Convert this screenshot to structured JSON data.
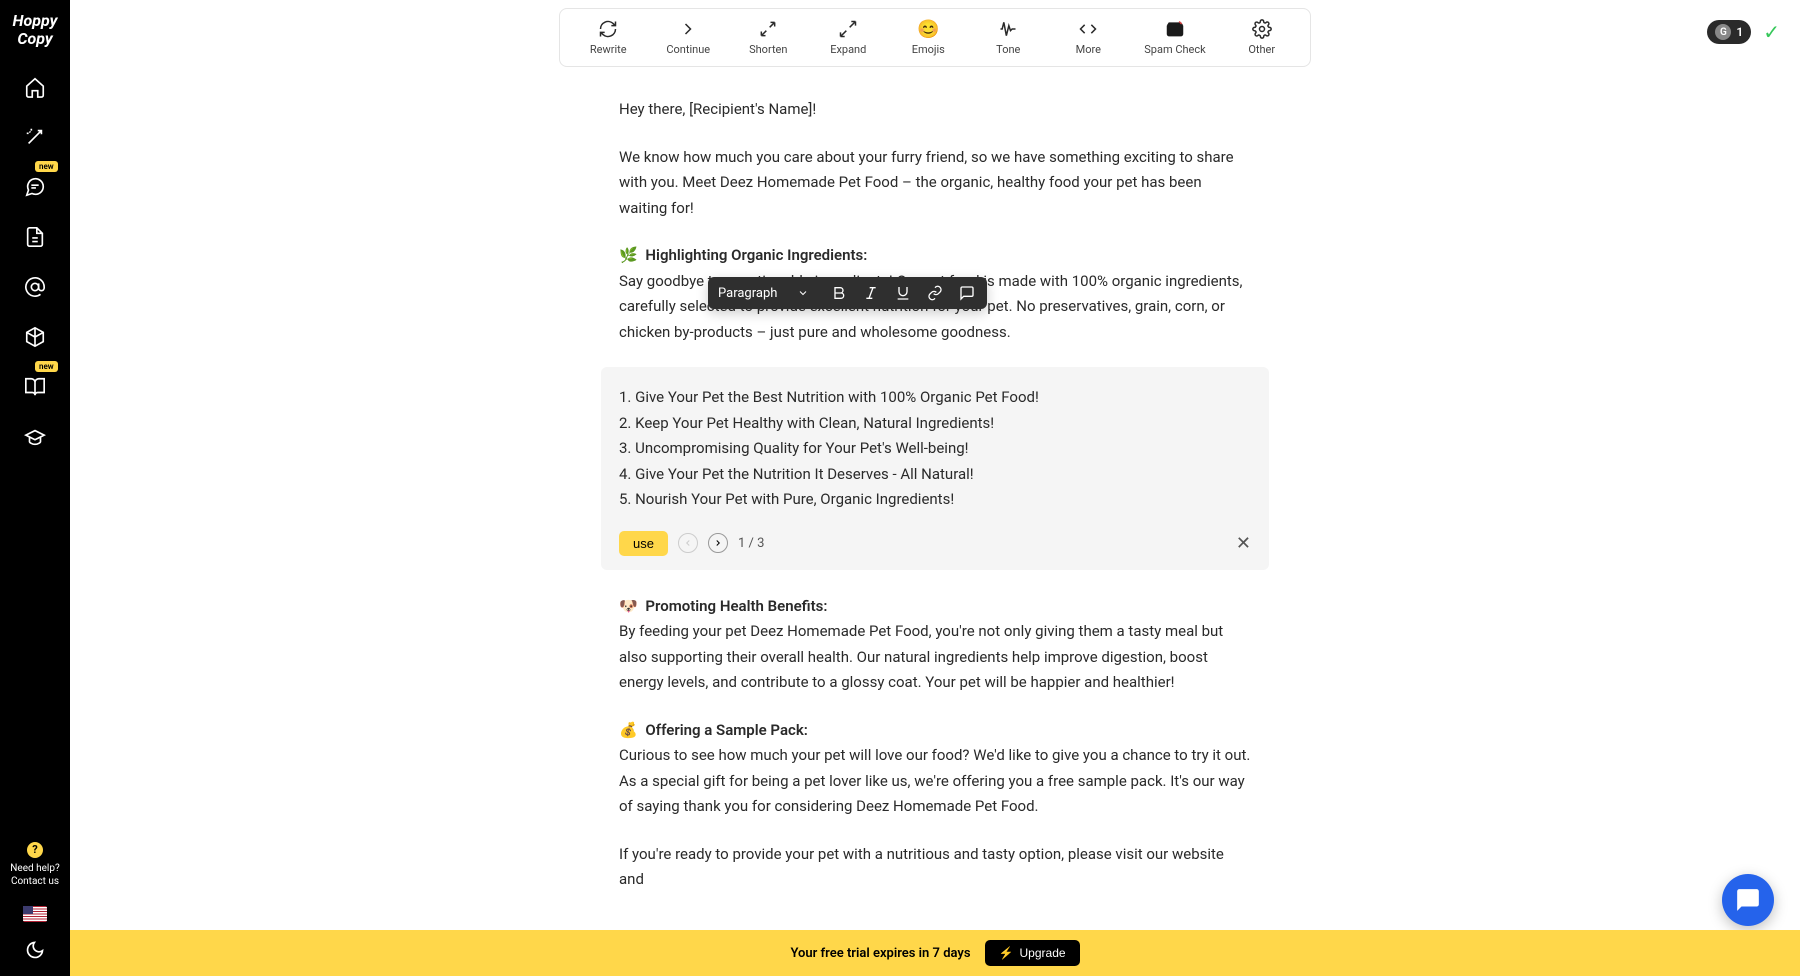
{
  "brand": "Hoppy Copy",
  "sidebar": {
    "new_badge": "new",
    "help_line1": "Need help?",
    "help_line2": "Contact us"
  },
  "toolbar": {
    "rewrite": "Rewrite",
    "continue": "Continue",
    "shorten": "Shorten",
    "expand": "Expand",
    "emojis": "Emojis",
    "tone": "Tone",
    "more": "More",
    "spam_check": "Spam Check",
    "other": "Other"
  },
  "credits": {
    "letter": "G",
    "count": "1"
  },
  "editor": {
    "greeting": "Hey there, [Recipient's Name]!",
    "intro": "We know how much you care about your furry friend, so we have something exciting to share with you. Meet Deez Homemade Pet Food – the organic, healthy food your pet has been waiting for!",
    "s1_emoji": "🌿",
    "s1_title": "Highlighting Organic Ingredients:",
    "s1_body": "Say goodbye to questionable ingredients! Our pet food is made with 100% organic ingredients, carefully selected to provide excellent nutrition for your pet. No preservatives, grain, corn, or chicken by-products – just pure and wholesome goodness.",
    "suggestions": [
      "1. Give Your Pet the Best Nutrition with 100% Organic Pet Food!",
      "2. Keep Your Pet Healthy with Clean, Natural Ingredients!",
      "3. Uncompromising Quality for Your Pet's Well-being!",
      "4. Give Your Pet the Nutrition It Deserves - All Natural!",
      "5. Nourish Your Pet with Pure, Organic Ingredients!"
    ],
    "use_label": "use",
    "pager": "1 / 3",
    "s2_emoji": "🐶",
    "s2_title": "Promoting Health Benefits:",
    "s2_body": "By feeding your pet Deez Homemade Pet Food, you're not only giving them a tasty meal but also supporting their overall health. Our natural ingredients help improve digestion, boost energy levels, and contribute to a glossy coat. Your pet will be happier and healthier!",
    "s3_emoji": "💰",
    "s3_title": "Offering a Sample Pack:",
    "s3_body": "Curious to see how much your pet will love our food? We'd like to give you a chance to try it out. As a special gift for being a pet lover like us, we're offering you a free sample pack. It's our way of saying thank you for considering Deez Homemade Pet Food.",
    "cta": "If you're ready to provide your pet with a nutritious and tasty option, please visit our website and"
  },
  "format_bar": {
    "style": "Paragraph"
  },
  "trial": {
    "text": "Your free trial expires in 7 days",
    "upgrade": "Upgrade"
  }
}
